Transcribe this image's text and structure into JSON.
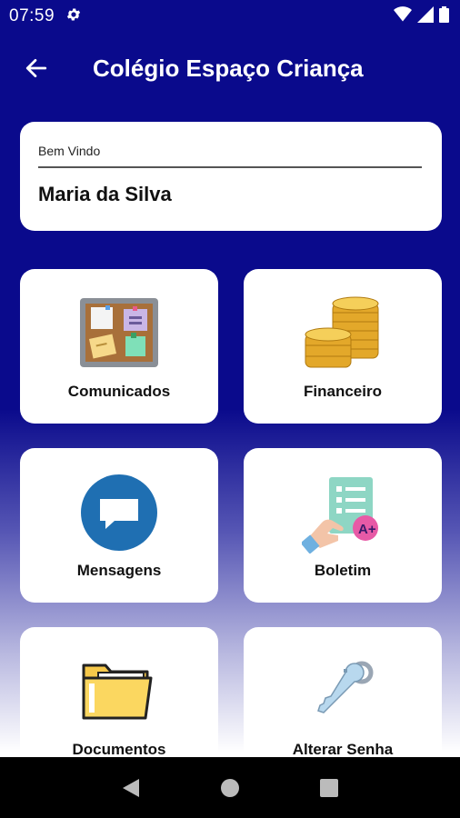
{
  "status_bar": {
    "time": "07:59",
    "icons": [
      "settings-icon",
      "wifi-icon",
      "signal-icon",
      "battery-icon"
    ]
  },
  "app_bar": {
    "back_icon": "arrow-left-icon",
    "title": "Colégio Espaço Criança"
  },
  "welcome": {
    "label": "Bem Vindo",
    "name": "Maria da Silva"
  },
  "menu": {
    "items": [
      {
        "label": "Comunicados",
        "icon": "bulletin-board-icon"
      },
      {
        "label": "Financeiro",
        "icon": "coins-icon"
      },
      {
        "label": "Mensagens",
        "icon": "chat-bubble-icon"
      },
      {
        "label": "Boletim",
        "icon": "report-card-icon"
      },
      {
        "label": "Documentos",
        "icon": "folder-icon"
      },
      {
        "label": "Alterar Senha",
        "icon": "key-icon"
      }
    ]
  },
  "nav_bar": {
    "icons": [
      "back-triangle-icon",
      "home-circle-icon",
      "recents-square-icon"
    ]
  },
  "colors": {
    "primary": "#0a0a8c",
    "card": "#ffffff",
    "message_blue": "#1f6fb2"
  }
}
